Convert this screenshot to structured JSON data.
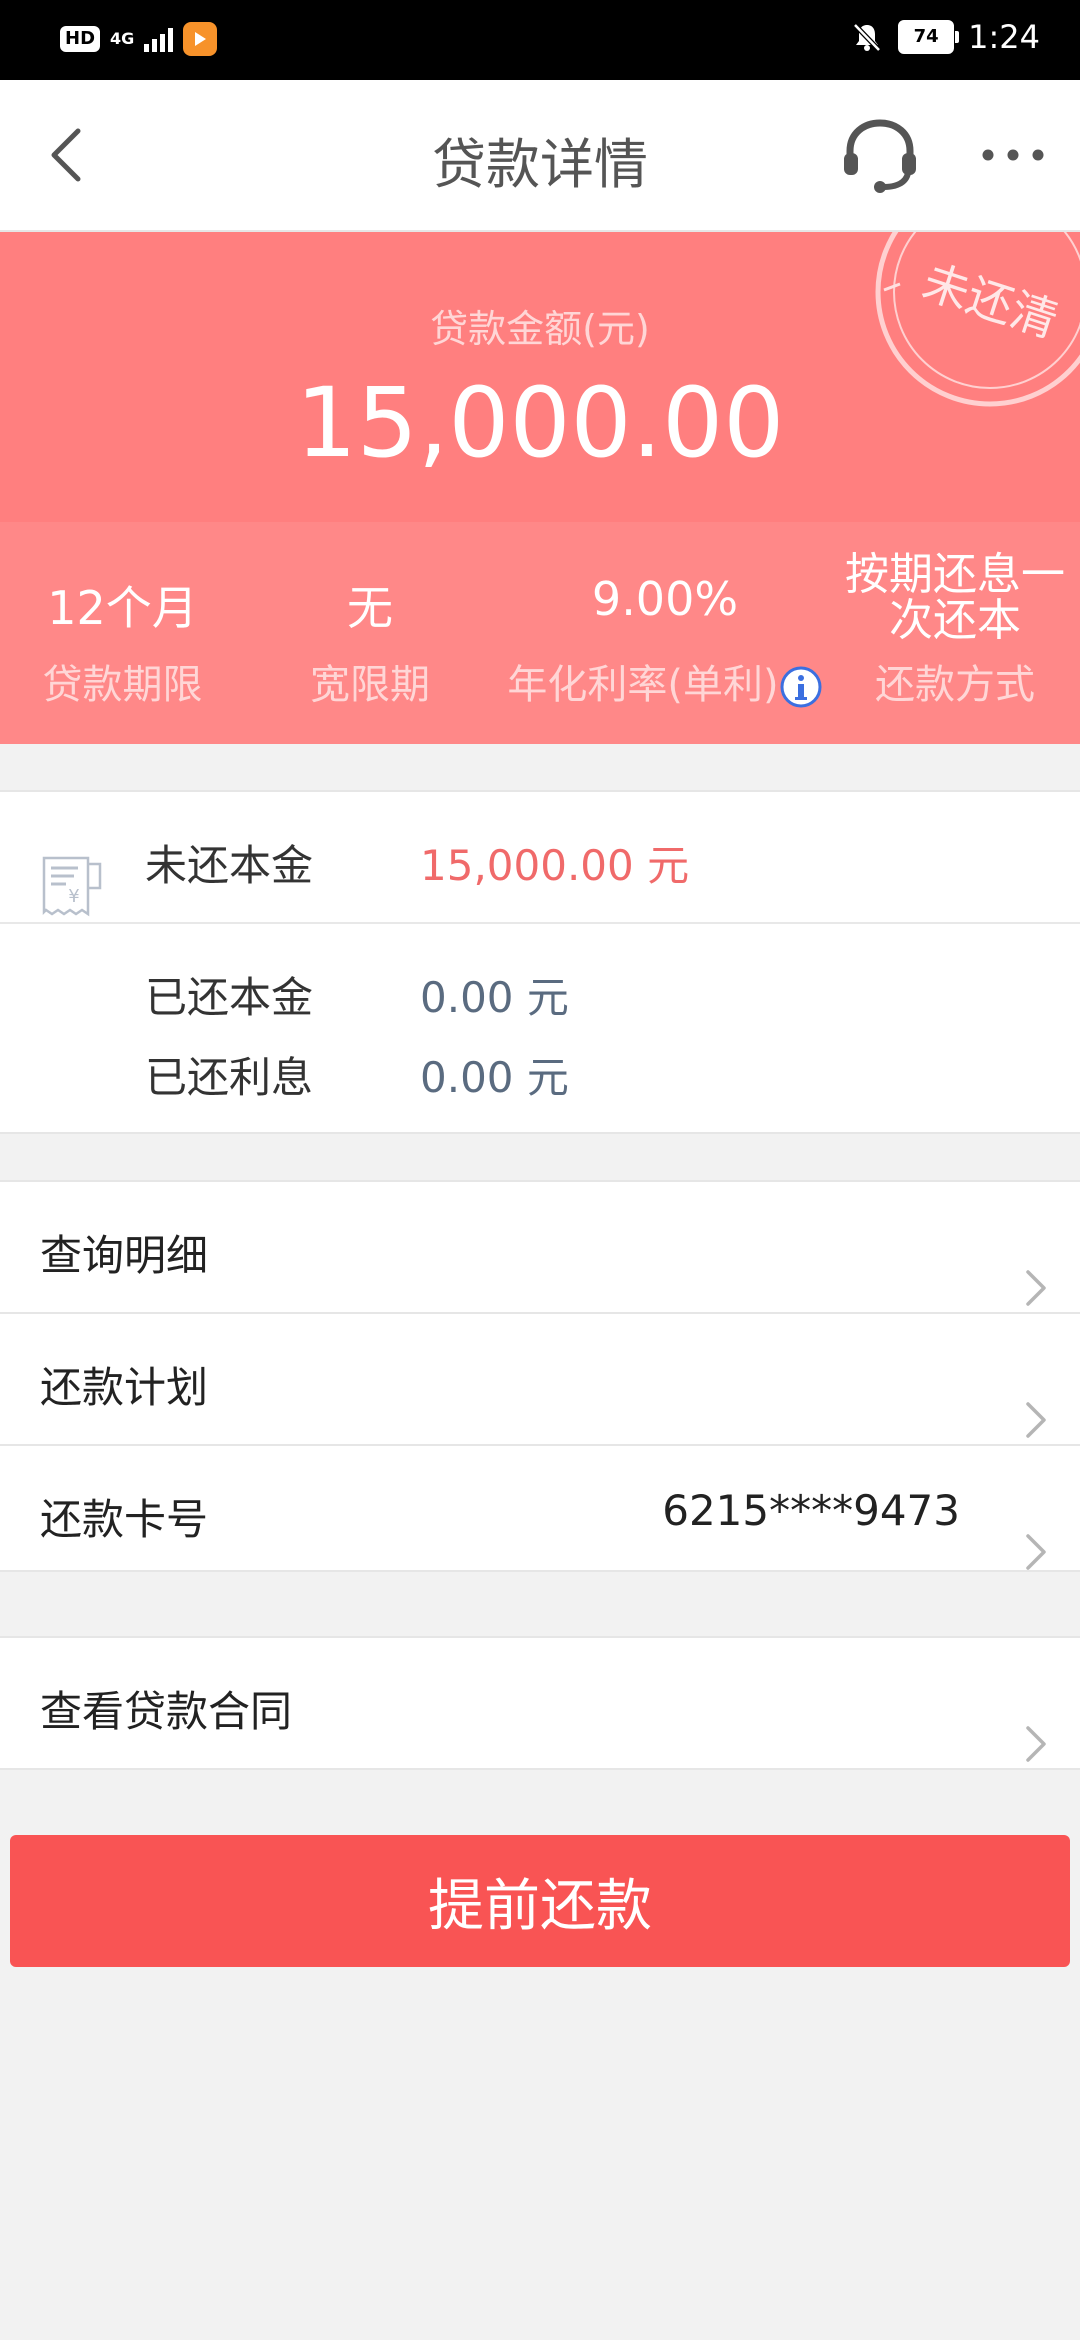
{
  "status_bar": {
    "hd": "HD",
    "network": "4G",
    "battery": "74",
    "time": "1:24"
  },
  "header": {
    "title": "贷款详情"
  },
  "loan": {
    "amount_label": "贷款金额(元)",
    "amount": "15,000.00",
    "stamp": "未还清",
    "terms": [
      {
        "value": "12个月",
        "label": "贷款期限"
      },
      {
        "value": "无",
        "label": "宽限期"
      },
      {
        "value": "9.00%",
        "label": "年化利率(单利)"
      },
      {
        "value_line1": "按期还息一",
        "value_line2": "次还本",
        "label": "还款方式"
      }
    ]
  },
  "principal": {
    "unpaid_label": "未还本金",
    "unpaid_value": "15,000.00 元",
    "paid_label": "已还本金",
    "paid_value": "0.00 元",
    "interest_label": "已还利息",
    "interest_value": "0.00 元"
  },
  "menu": {
    "query_details": "查询明细",
    "repayment_plan": "还款计划",
    "card_label": "还款卡号",
    "card_value": "6215****9473",
    "contract": "查看贷款合同"
  },
  "button": {
    "prepay": "提前还款"
  },
  "colors": {
    "hero": "#ff7f7f",
    "terms_band": "#ff8888",
    "button": "#f95454",
    "accent_red": "#f06a6a",
    "info_blue": "#3b6fe0"
  }
}
